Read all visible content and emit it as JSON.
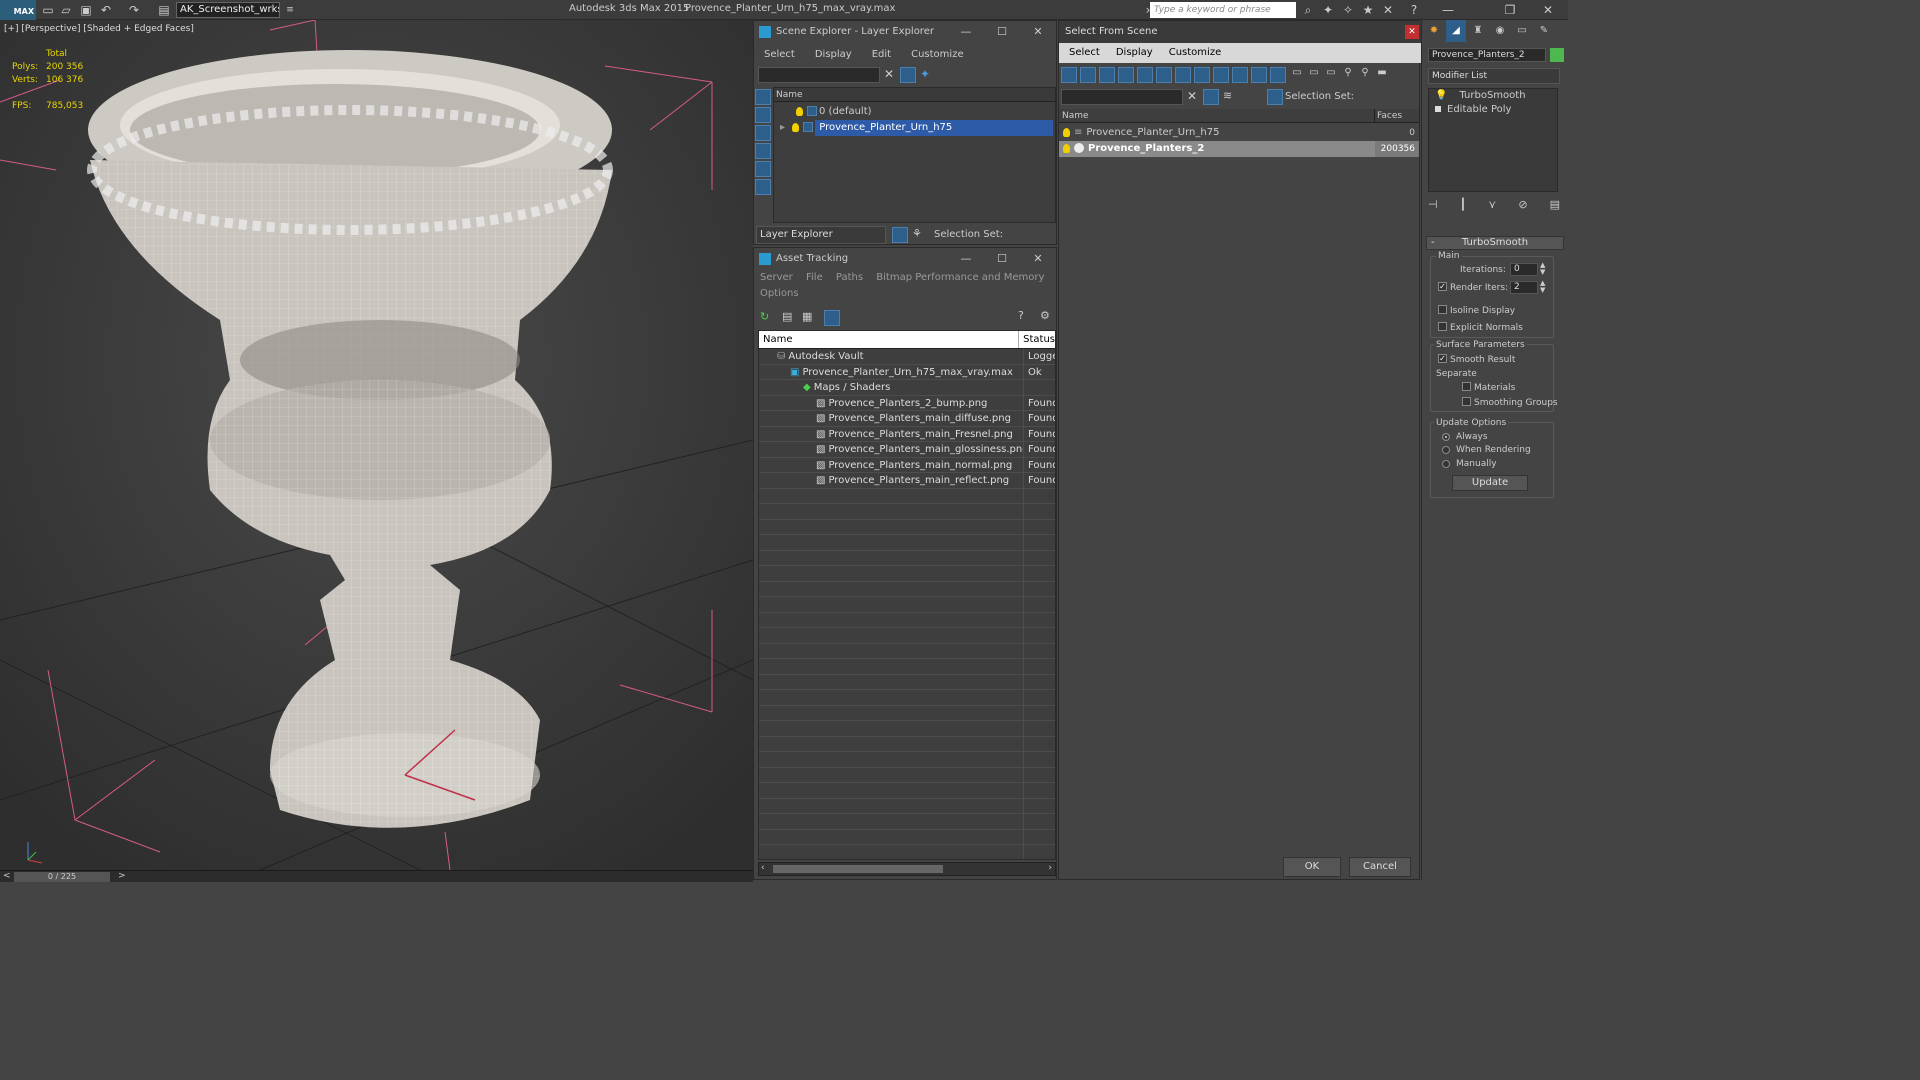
{
  "titlebar": {
    "workspace": "AK_Screenshot_wrksp",
    "app_title": "Autodesk 3ds Max  2015",
    "file_title": "Provence_Planter_Urn_h75_max_vray.max",
    "search_placeholder": "Type a keyword or phrase"
  },
  "viewport": {
    "label": "[+] [Perspective] [Shaded + Edged Faces]",
    "stats": {
      "total_label": "Total",
      "polys_label": "Polys:",
      "polys": "200 356",
      "verts_label": "Verts:",
      "verts": "106 376",
      "fps_label": "FPS:",
      "fps": "785,053"
    }
  },
  "timeline": {
    "frame": "0 / 225",
    "prev": "<",
    "next": ">"
  },
  "scene_explorer": {
    "title": "Scene Explorer - Layer Explorer",
    "menu": [
      "Select",
      "Display",
      "Edit",
      "Customize"
    ],
    "column": "Name",
    "layers": [
      "0 (default)",
      "Provence_Planter_Urn_h75"
    ],
    "footer_dropdown": "Layer Explorer",
    "selection_set_label": "Selection Set:"
  },
  "asset_tracking": {
    "title": "Asset Tracking",
    "menu1": [
      "Server",
      "File",
      "Paths",
      "Bitmap Performance and Memory"
    ],
    "menu2": [
      "Options"
    ],
    "columns": [
      "Name",
      "Status"
    ],
    "rows": [
      {
        "name": "Autodesk Vault",
        "status": "Logged",
        "indent": 0
      },
      {
        "name": "Provence_Planter_Urn_h75_max_vray.max",
        "status": "Ok",
        "indent": 1
      },
      {
        "name": "Maps / Shaders",
        "status": "",
        "indent": 2
      },
      {
        "name": "Provence_Planters_2_bump.png",
        "status": "Found",
        "indent": 3
      },
      {
        "name": "Provence_Planters_main_diffuse.png",
        "status": "Found",
        "indent": 3
      },
      {
        "name": "Provence_Planters_main_Fresnel.png",
        "status": "Found",
        "indent": 3
      },
      {
        "name": "Provence_Planters_main_glossiness.png",
        "status": "Found",
        "indent": 3
      },
      {
        "name": "Provence_Planters_main_normal.png",
        "status": "Found",
        "indent": 3
      },
      {
        "name": "Provence_Planters_main_reflect.png",
        "status": "Found",
        "indent": 3
      }
    ]
  },
  "select_from_scene": {
    "title": "Select From Scene",
    "menu": [
      "Select",
      "Display",
      "Customize"
    ],
    "selection_set_label": "Selection Set:",
    "columns": [
      "Name",
      "Faces"
    ],
    "rows": [
      {
        "name": "Provence_Planter_Urn_h75",
        "faces": "0"
      },
      {
        "name": "Provence_Planters_2",
        "faces": "200356"
      }
    ],
    "ok": "OK",
    "cancel": "Cancel"
  },
  "command_panel": {
    "object_name": "Provence_Planters_2",
    "modifier_list": "Modifier List",
    "stack": [
      "TurboSmooth",
      "Editable Poly"
    ],
    "rollout_title": "TurboSmooth",
    "main_label": "Main",
    "iterations_label": "Iterations:",
    "iterations": "0",
    "render_iters_label": "Render Iters:",
    "render_iters": "2",
    "isoline": "Isoline Display",
    "explicit_normals": "Explicit Normals",
    "surface_params": "Surface Parameters",
    "smooth_result": "Smooth Result",
    "separate": "Separate",
    "materials": "Materials",
    "smoothing_groups": "Smoothing Groups",
    "update_options": "Update Options",
    "always": "Always",
    "when_rendering": "When Rendering",
    "manually": "Manually",
    "update": "Update"
  },
  "colors": {
    "accent": "#2e5ba8",
    "stats": "#e8d600",
    "bg": "#444444"
  }
}
